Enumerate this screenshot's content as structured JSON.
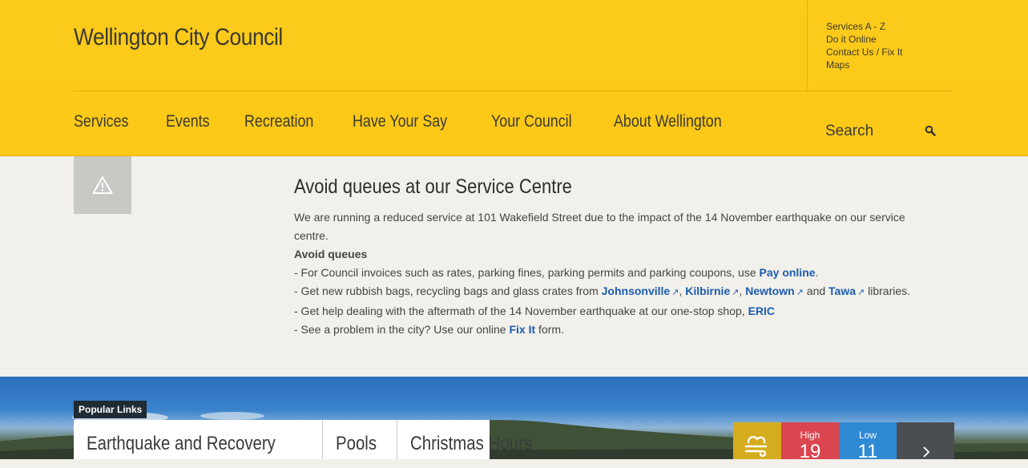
{
  "header": {
    "site_title": "Wellington City Council",
    "quick_links": [
      "Services A - Z",
      "Do it Online",
      "Contact Us / Fix It",
      "Maps"
    ],
    "nav": [
      "Services",
      "Events",
      "Recreation",
      "Have Your Say",
      "Your Council",
      "About Wellington"
    ],
    "search": {
      "placeholder": "Search"
    },
    "colors": {
      "background": "#fccb1b",
      "text": "#3a3a30"
    }
  },
  "notice": {
    "icon": "warning-icon",
    "title": "Avoid queues at our Service Centre",
    "intro": "We are running a reduced service at 101 Wakefield Street due to the impact of the 14 November earthquake on our service centre.",
    "subheading": "Avoid queues",
    "line1_pre": "- For Council invoices such as rates, parking fines, parking permits and parking coupons, use ",
    "line1_link": "Pay online",
    "line1_post": ".",
    "line2_pre": "- Get new rubbish bags, recycling bags and glass crates from ",
    "line2_links": [
      "Johnsonville",
      "Kilbirnie",
      "Newtown",
      "Tawa"
    ],
    "line2_sep1": ", ",
    "line2_sep2": ", ",
    "line2_sep3": " and ",
    "line2_post": " libraries.",
    "line3_pre": "- Get help dealing with the aftermath of the 14 November earthquake at our one-stop shop, ",
    "line3_link": "ERIC",
    "line4_pre": "- See a problem in the city? Use our online ",
    "line4_link": "Fix It",
    "line4_post": " form.",
    "link_color": "#1a5cb0"
  },
  "hero": {
    "popular_label": "Popular Links",
    "popular_links": [
      "Earthquake and Recovery",
      "Pools",
      "Christmas Hours"
    ]
  },
  "weather": {
    "icon": "wind-cloud-icon",
    "high_label": "High",
    "high_value": "19",
    "low_label": "Low",
    "low_value": "11",
    "next_icon": "chevron-right-icon",
    "colors": {
      "icon_bg": "#d6ac1f",
      "high_bg": "#d9464f",
      "low_bg": "#2f8ad4",
      "next_bg": "#4a4e52"
    }
  }
}
